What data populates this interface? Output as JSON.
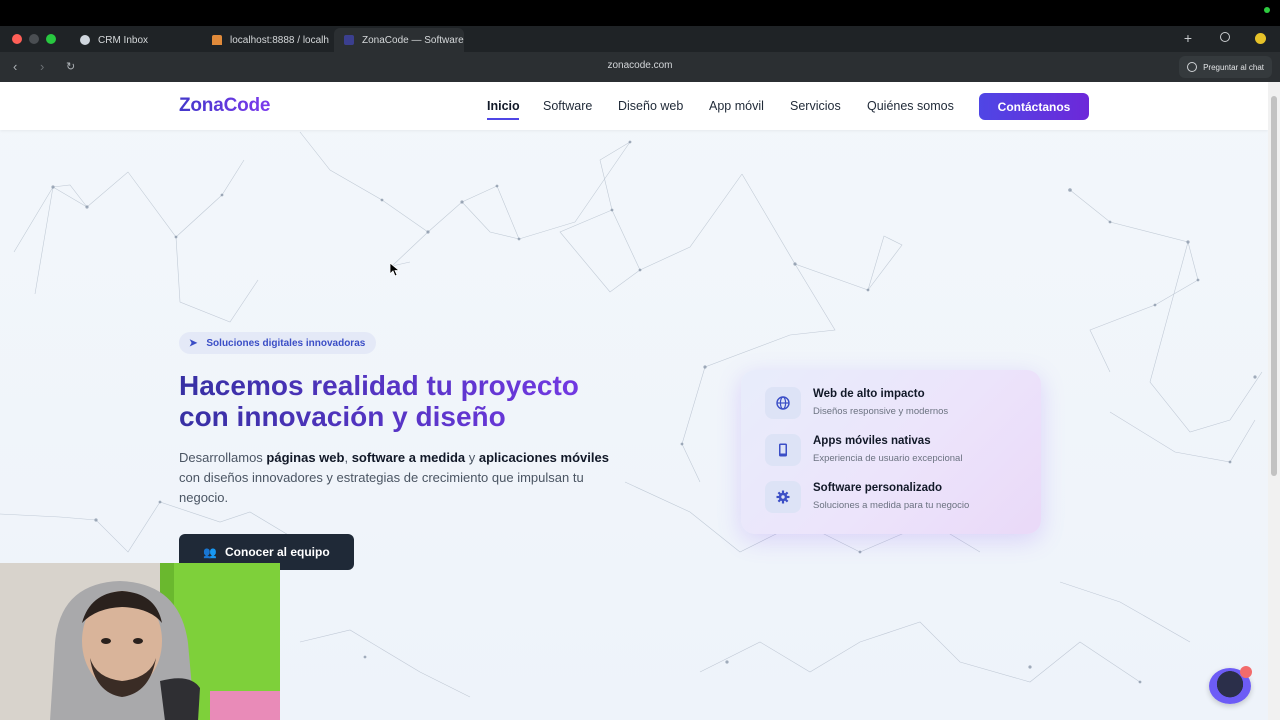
{
  "browser": {
    "tabs": [
      {
        "label": "CRM Inbox",
        "active": false
      },
      {
        "label": "localhost:8888 / localh",
        "active": false
      },
      {
        "label": "ZonaCode — Software",
        "active": true
      }
    ],
    "url": "zonacode.com",
    "ask_chat_label": "Preguntar al chat"
  },
  "site": {
    "logo": "ZonaCode",
    "nav": [
      "Inicio",
      "Software",
      "Diseño web",
      "App móvil",
      "Servicios",
      "Quiénes somos"
    ],
    "nav_active": "Inicio",
    "cta": "Contáctanos"
  },
  "hero": {
    "badge": "Soluciones digitales innovadoras",
    "title_line1": "Hacemos realidad tu proyecto",
    "title_line2": "con innovación y diseño",
    "desc": {
      "p1": "Desarrollamos ",
      "b1": "páginas web",
      "p2": ", ",
      "b2": "software a medida",
      "p3": " y ",
      "b3": "aplicaciones móviles",
      "p4": " con diseños innovadores y estrategias de crecimiento que impulsan tu negocio."
    },
    "team_button": "Conocer al equipo"
  },
  "features": [
    {
      "icon": "globe-icon",
      "title": "Web de alto impacto",
      "subtitle": "Diseños responsive y modernos"
    },
    {
      "icon": "mobile-icon",
      "title": "Apps móviles nativas",
      "subtitle": "Experiencia de usuario excepcional"
    },
    {
      "icon": "gear-icon",
      "title": "Software personalizado",
      "subtitle": "Soluciones a medida para tu negocio"
    }
  ],
  "colors": {
    "brand_indigo": "#4f46e5",
    "brand_violet": "#7c3aed",
    "dark_button": "#1f2937",
    "badge_bg": "#e4e9f7"
  }
}
